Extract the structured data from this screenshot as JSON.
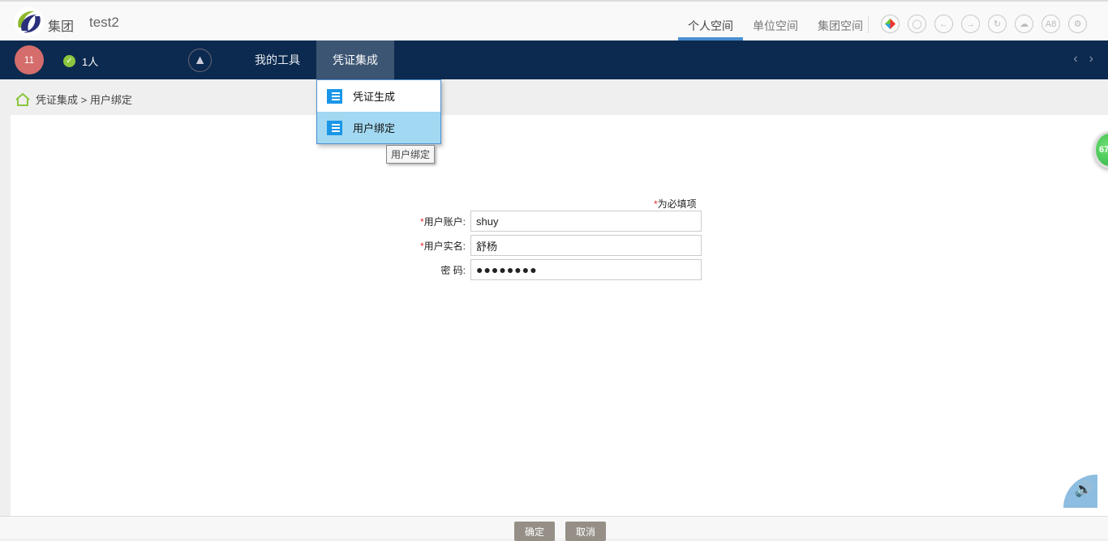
{
  "header": {
    "org": "集团",
    "account": "test2",
    "spaces": [
      "个人空间",
      "单位空间",
      "集团空间"
    ],
    "icon_a8": "A8"
  },
  "nav": {
    "message_count": "11",
    "online": "1人",
    "menus": [
      "我的工具",
      "凭证集成"
    ],
    "green_badge": "67"
  },
  "dropdown": {
    "items": [
      "凭证生成",
      "用户绑定"
    ],
    "tooltip": "用户绑定"
  },
  "breadcrumb": {
    "path": "凭证集成 > 用户绑定"
  },
  "form": {
    "required_note": "为必填项",
    "star": "*",
    "account_label": "用户账户:",
    "account_value": "shuy",
    "name_label": "用户实名:",
    "name_value": "舒杨",
    "password_label": "密 码:",
    "password_value": "●●●●●●●●"
  },
  "footer": {
    "confirm": "确定",
    "cancel": "取消"
  }
}
